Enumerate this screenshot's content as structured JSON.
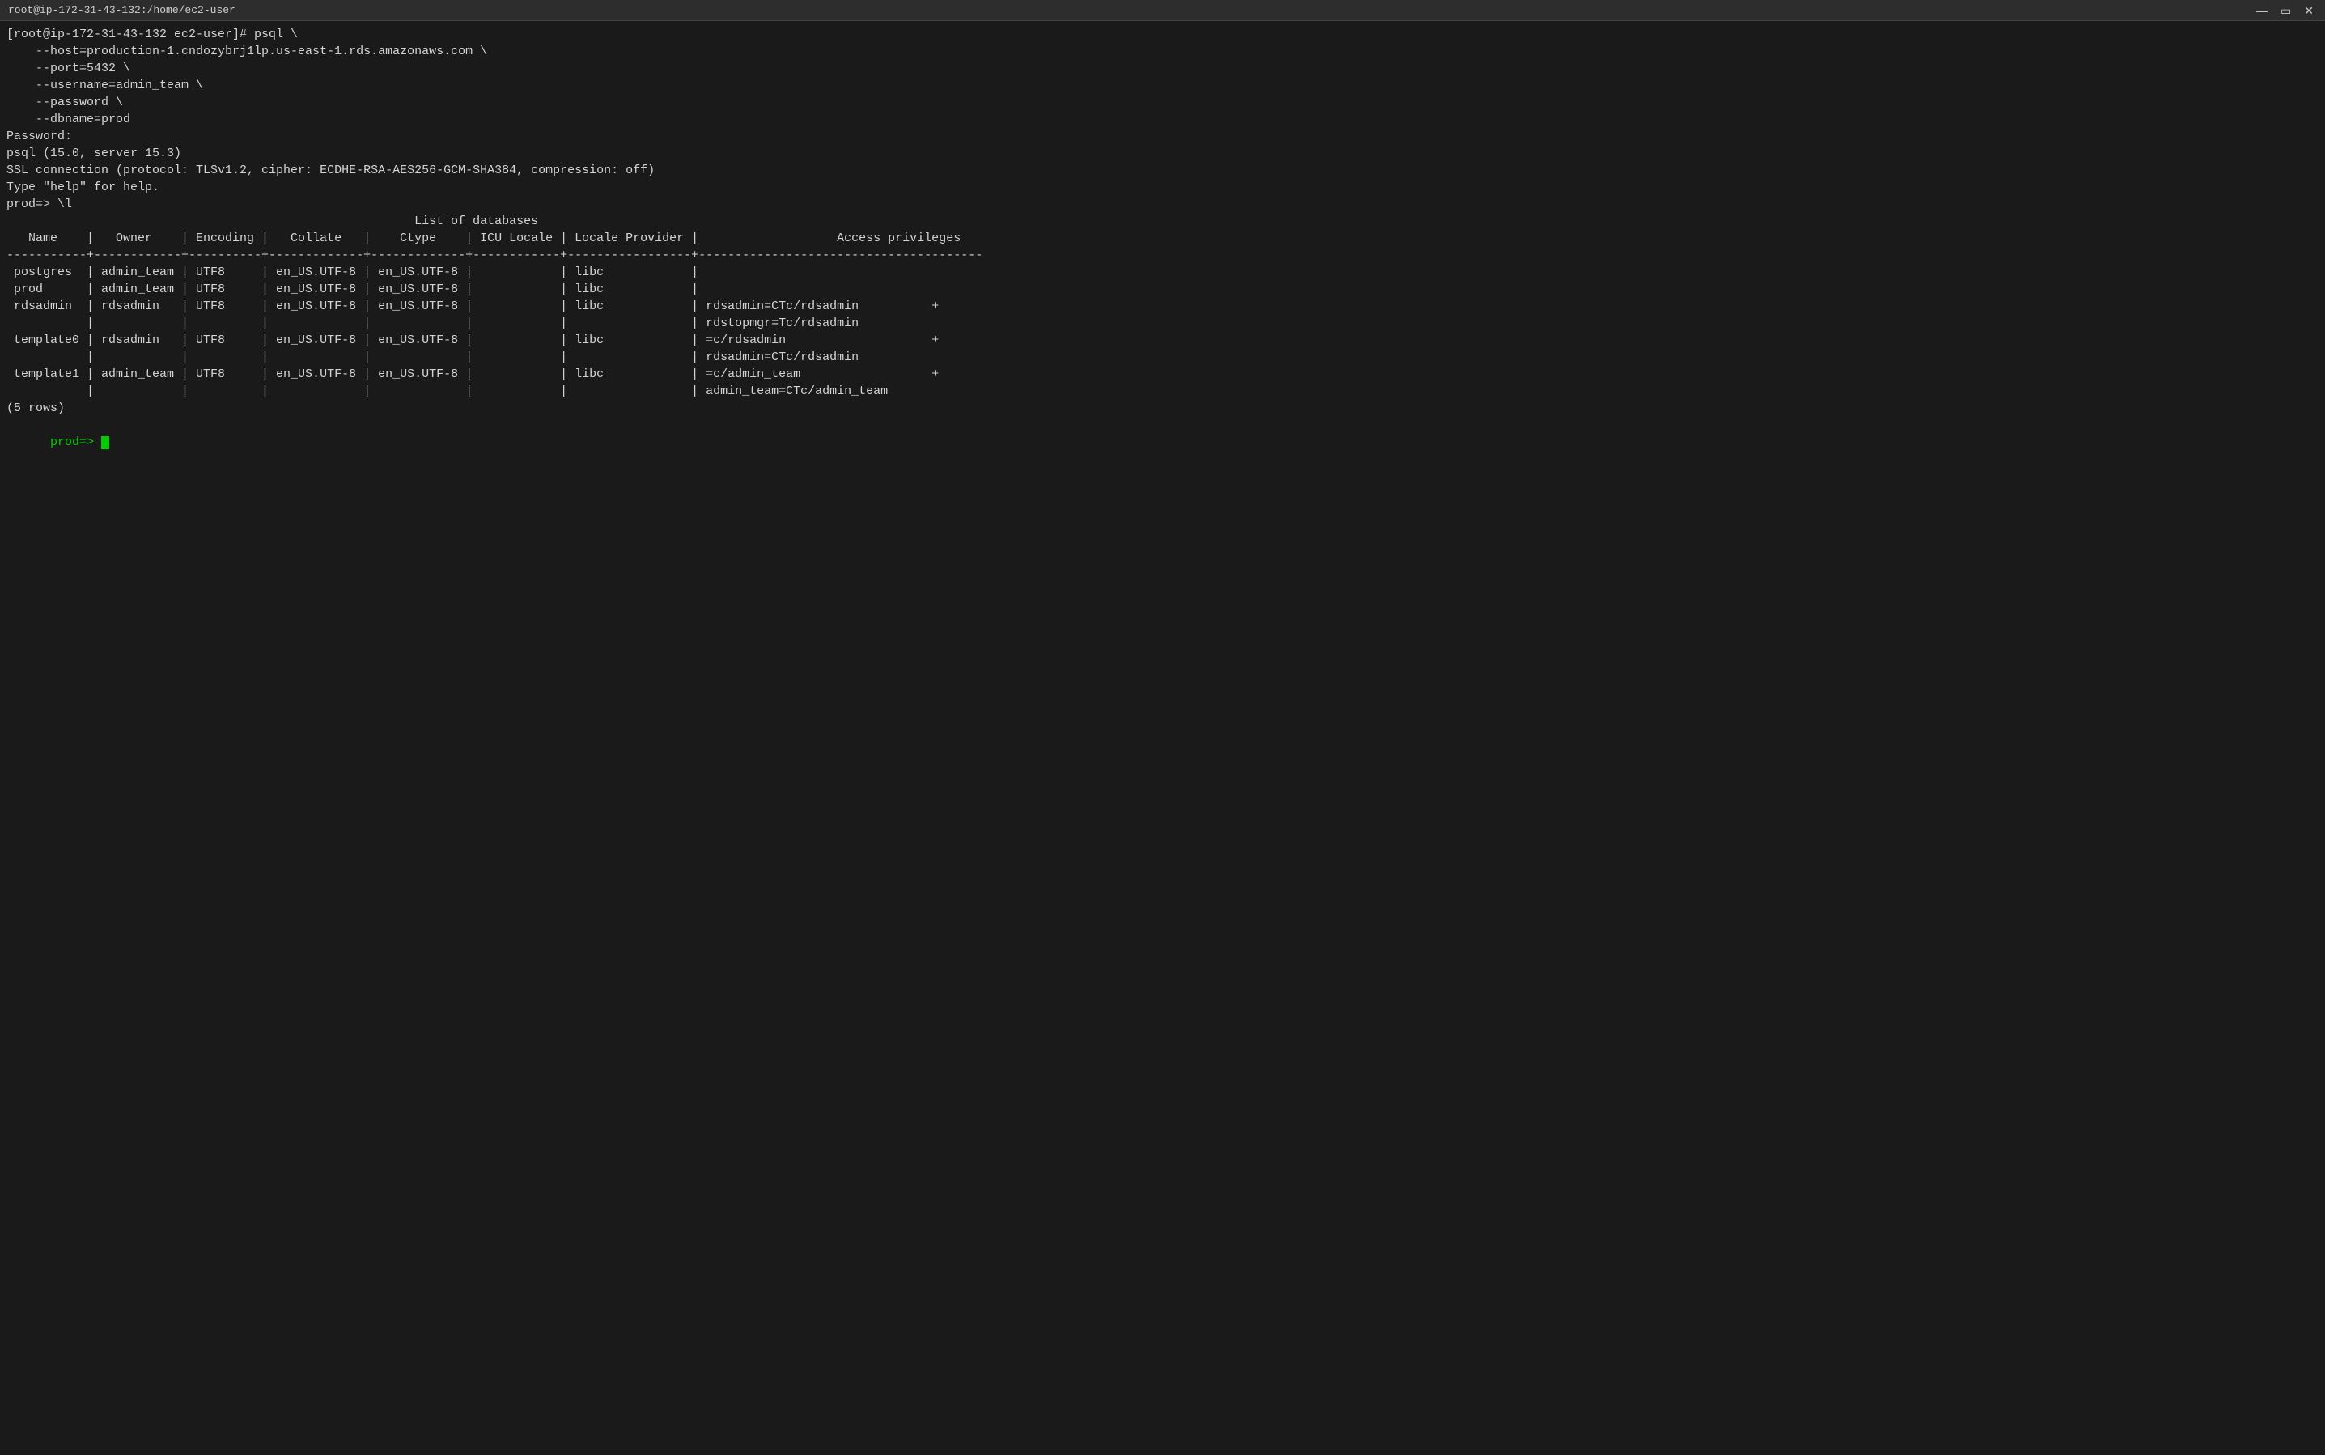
{
  "window": {
    "title": "root@ip-172-31-43-132:/home/ec2-user"
  },
  "titlebar": {
    "minimize_label": "—",
    "maximize_label": "▭",
    "close_label": "✕"
  },
  "terminal": {
    "lines": [
      "[root@ip-172-31-43-132 ec2-user]# psql \\",
      "    --host=production-1.cndozybrj1lp.us-east-1.rds.amazonaws.com \\",
      "    --port=5432 \\",
      "    --username=admin_team \\",
      "    --password \\",
      "    --dbname=prod",
      "Password: ",
      "psql (15.0, server 15.3)",
      "SSL connection (protocol: TLSv1.2, cipher: ECDHE-RSA-AES256-GCM-SHA384, compression: off)",
      "Type \"help\" for help.",
      "",
      "prod=> \\l",
      "                                                        List of databases",
      "   Name    |   Owner    | Encoding |   Collate   |    Ctype    | ICU Locale | Locale Provider |                   Access privileges",
      "-----------+------------+----------+-------------+-------------+------------+-----------------+---------------------------------------",
      " postgres  | admin_team | UTF8     | en_US.UTF-8 | en_US.UTF-8 |            | libc            |",
      " prod      | admin_team | UTF8     | en_US.UTF-8 | en_US.UTF-8 |            | libc            |",
      " rdsadmin  | rdsadmin   | UTF8     | en_US.UTF-8 | en_US.UTF-8 |            | libc            | rdsadmin=CTc/rdsadmin          +",
      "           |            |          |             |             |            |                 | rdstopmgr=Tc/rdsadmin",
      " template0 | rdsadmin   | UTF8     | en_US.UTF-8 | en_US.UTF-8 |            | libc            | =c/rdsadmin                    +",
      "           |            |          |             |             |            |                 | rdsadmin=CTc/rdsadmin",
      " template1 | admin_team | UTF8     | en_US.UTF-8 | en_US.UTF-8 |            | libc            | =c/admin_team                  +",
      "           |            |          |             |             |            |                 | admin_team=CTc/admin_team",
      "(5 rows)",
      ""
    ],
    "prompt": "prod=> "
  }
}
